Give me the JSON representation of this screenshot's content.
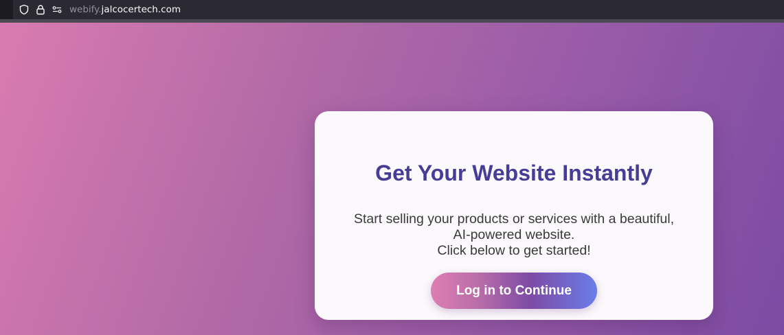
{
  "browser": {
    "url_subdomain": "webify.",
    "url_domain": "jalcocertech.com",
    "icons": [
      "shield-icon",
      "lock-icon",
      "permissions-icon"
    ]
  },
  "card": {
    "title": "Get Your Website Instantly",
    "body_line1": "Start selling your products or services with a beautiful,",
    "body_line2": "AI-powered website.",
    "body_line3": "Click below to get started!",
    "button_label": "Log in to Continue"
  },
  "colors": {
    "title": "#463d96",
    "background_start": "#d97bb0",
    "background_end": "#7c4ba3",
    "button_start": "#de7fb2",
    "button_end": "#6b7de9"
  }
}
